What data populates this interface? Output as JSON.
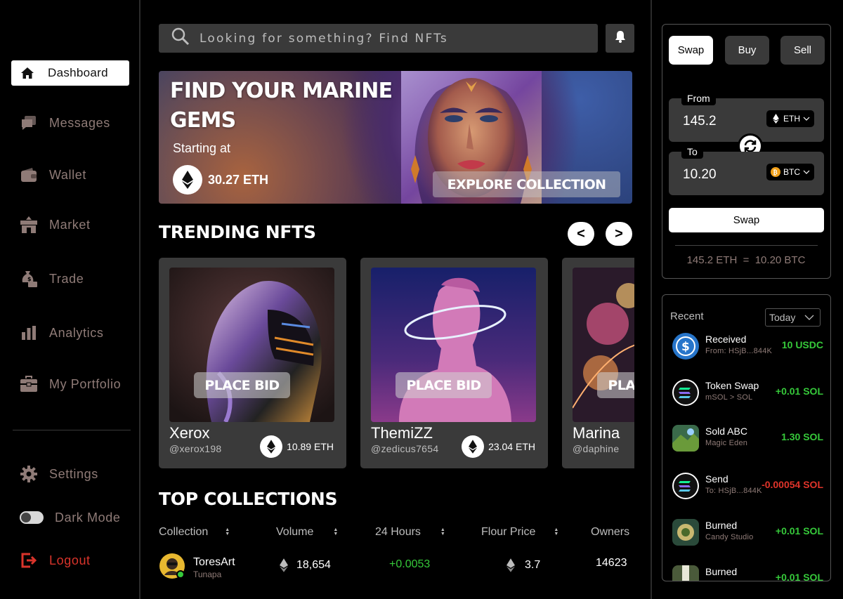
{
  "sidebar": {
    "items": [
      {
        "label": "Dashboard",
        "icon": "home-icon"
      },
      {
        "label": "Messages",
        "icon": "messages-icon"
      },
      {
        "label": "Wallet",
        "icon": "wallet-icon"
      },
      {
        "label": "Market",
        "icon": "market-icon"
      },
      {
        "label": "Trade",
        "icon": "trade-icon"
      },
      {
        "label": "Analytics",
        "icon": "analytics-icon"
      },
      {
        "label": "My Portfolio",
        "icon": "portfolio-icon"
      }
    ],
    "settings": "Settings",
    "dark_mode": "Dark Mode",
    "logout": "Logout"
  },
  "search": {
    "placeholder": "Looking for something? Find NFTs"
  },
  "hero": {
    "title": "FIND YOUR MARINE GEMS",
    "subtitle": "Starting at",
    "price": "30.27 ETH",
    "cta": "EXPLORE COLLECTION"
  },
  "trending": {
    "title": "TRENDING NFTS",
    "prev": "<",
    "next": ">",
    "cards": [
      {
        "name": "Xerox",
        "handle": "@xerox198",
        "price": "10.89 ETH",
        "bid": "PLACE BID"
      },
      {
        "name": "ThemiZZ",
        "handle": "@zedicus7654",
        "price": "23.04 ETH",
        "bid": "PLACE BID"
      },
      {
        "name": "Marina",
        "handle": "@daphine",
        "price": "",
        "bid": "PLACE BID"
      }
    ]
  },
  "collections": {
    "title": "TOP COLLECTIONS",
    "columns": [
      "Collection",
      "Volume",
      "24 Hours",
      "Flour Price",
      "Owners"
    ],
    "rows": [
      {
        "name": "ToresArt",
        "sub": "Tunapa",
        "volume": "18,654",
        "change": "+0.0053",
        "floor": "3.7",
        "owners": "14623"
      }
    ]
  },
  "swap": {
    "tabs": [
      "Swap",
      "Buy",
      "Sell"
    ],
    "from_label": "From",
    "from_value": "145.2",
    "from_token": "ETH",
    "to_label": "To",
    "to_value": "10.20",
    "to_token": "BTC",
    "button": "Swap",
    "rate": "145.2 ETH  =  10.20 BTC"
  },
  "recent": {
    "title": "Recent",
    "filter": "Today",
    "items": [
      {
        "title": "Received",
        "sub": "From: HSjB...844K",
        "amount": "10 USDC",
        "status": "positive",
        "icon": "usdc-icon"
      },
      {
        "title": "Token Swap",
        "sub": "mSOL > SOL",
        "amount": "+0.01 SOL",
        "status": "positive",
        "icon": "solana-icon"
      },
      {
        "title": "Sold ABC",
        "sub": "Magic Eden",
        "amount": "1.30 SOL",
        "status": "positive",
        "icon": "nft-thumbnail"
      },
      {
        "title": "Send",
        "sub": "To: HSjB...844K",
        "amount": "-0.00054 SOL",
        "status": "negative",
        "icon": "solana-icon"
      },
      {
        "title": "Burned",
        "sub": "Candy Studio",
        "amount": "+0.01 SOL",
        "status": "positive",
        "icon": "nft-thumbnail"
      },
      {
        "title": "Burned",
        "sub": "",
        "amount": "+0.01 SOL",
        "status": "positive",
        "icon": "nft-thumbnail"
      }
    ]
  },
  "colors": {
    "positive": "#36c93a",
    "negative": "#e0342a",
    "muted": "#8f7b77",
    "panel": "#3a3a3a"
  }
}
